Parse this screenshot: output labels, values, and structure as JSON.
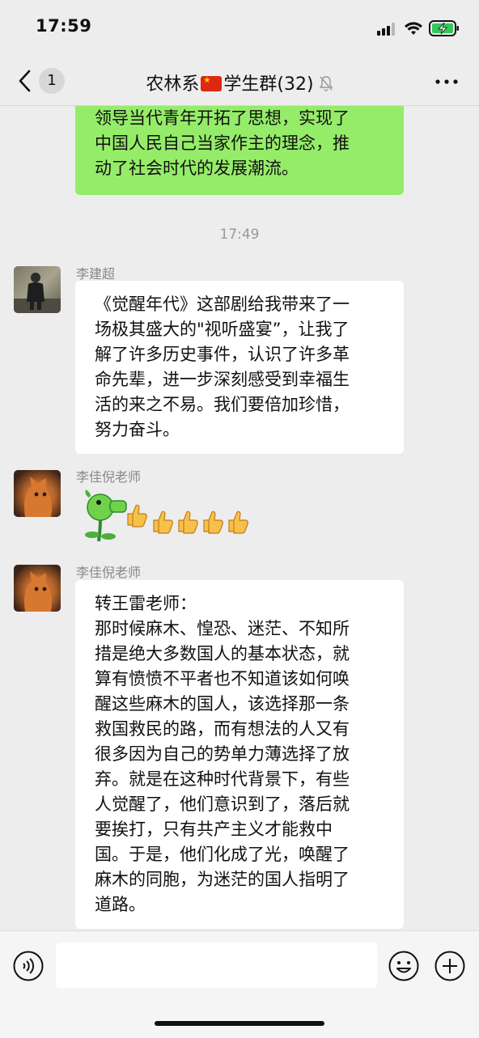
{
  "status_bar": {
    "time": "17:59"
  },
  "nav": {
    "back_count": "1",
    "title_left": "农林系",
    "title_right": "学生群(32)"
  },
  "messages": {
    "first": {
      "lines": "领导当代青年开拓了思想，实现了\n中国人民自己当家作主的理念，推\n动了社会时代的发展潮流。"
    },
    "timestamp": "17:49",
    "m1": {
      "sender": "李建超",
      "text": "《觉醒年代》这部剧给我带来了一\n场极其盛大的\"视听盛宴”，让我了\n解了许多历史事件，认识了许多革\n命先辈，进一步深刻感受到幸福生\n活的来之不易。我们要倍加珍惜，\n努力奋斗。"
    },
    "m2": {
      "sender": "李佳倪老师",
      "content": "peashooter-emoji thumbs-up-emoji x5"
    },
    "m3": {
      "sender": "李佳倪老师",
      "text": "转王雷老师：\n那时候麻木、惶恐、迷茫、不知所\n措是绝大多数国人的基本状态，就\n算有愤愤不平者也不知道该如何唤\n醒这些麻木的国人，该选择那一条\n救国救民的路，而有想法的人又有\n很多因为自己的势单力薄选择了放\n弃。就是在这种时代背景下，有些\n人觉醒了，他们意识到了，落后就\n要挨打，只有共产主义才能救中\n国。于是，他们化成了光，唤醒了\n麻木的同胞，为迷茫的国人指明了\n道路。"
    }
  },
  "colors": {
    "background": "#ededed",
    "outgoing_bubble": "#95ec69",
    "incoming_bubble": "#ffffff"
  }
}
